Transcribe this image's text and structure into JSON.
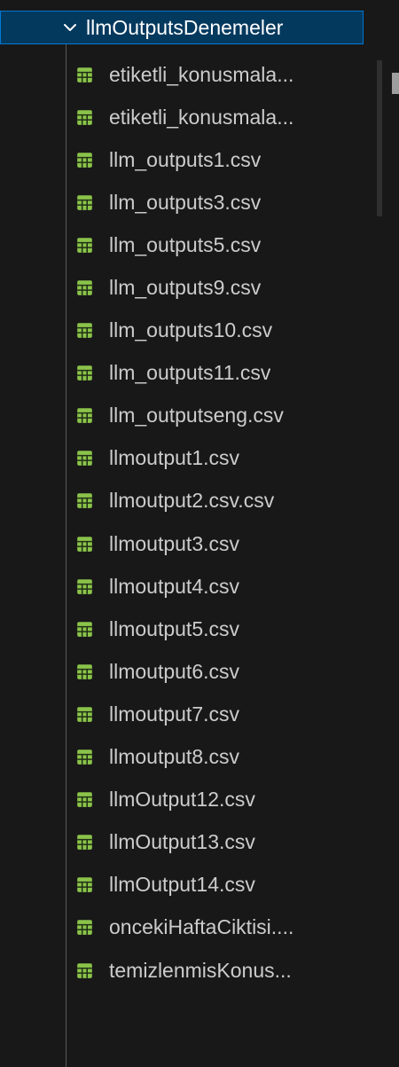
{
  "explorer": {
    "folder": {
      "label": "llmOutputsDenemeler",
      "icon": "chevron-down-icon"
    },
    "file_icon": "spreadsheet-icon",
    "colors": {
      "folder_selected_bg": "#04395e",
      "folder_selected_border": "#0078d4",
      "csv_icon": "#8bc34a",
      "background": "#181818"
    },
    "files": [
      "etiketli_konusmala...",
      "etiketli_konusmala...",
      "llm_outputs1.csv",
      "llm_outputs3.csv",
      "llm_outputs5.csv",
      "llm_outputs9.csv",
      "llm_outputs10.csv",
      "llm_outputs11.csv",
      "llm_outputseng.csv",
      "llmoutput1.csv",
      "llmoutput2.csv.csv",
      "llmoutput3.csv",
      "llmoutput4.csv",
      "llmoutput5.csv",
      "llmoutput6.csv",
      "llmoutput7.csv",
      "llmoutput8.csv",
      "llmOutput12.csv",
      "llmOutput13.csv",
      "llmOutput14.csv",
      "oncekiHaftaCiktisi....",
      "temizlenmisKonus..."
    ]
  }
}
